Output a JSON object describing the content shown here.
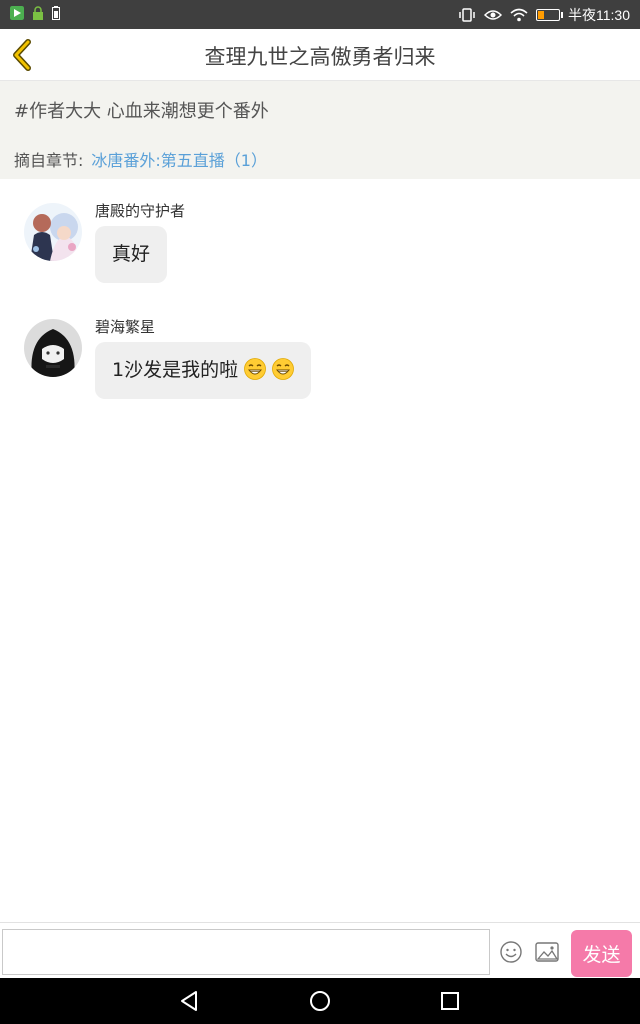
{
  "status_bar": {
    "time_text": "半夜11:30",
    "battery_level": 0.3,
    "icons": [
      "app-icon",
      "lock-icon",
      "battery-small-icon",
      "vibrate-icon",
      "eye-icon",
      "wifi-icon",
      "battery-icon"
    ]
  },
  "header": {
    "title": "查理九世之高傲勇者归来",
    "back_icon": "chevron-left-icon"
  },
  "quote": {
    "text": "#作者大大 心血来潮想更个番外",
    "source_label": "摘自章节:",
    "source_link": "冰唐番外:第五直播（1）"
  },
  "comments": [
    {
      "username": "唐殿的守护者",
      "message": "真好",
      "emojis": 0
    },
    {
      "username": "碧海繁星",
      "message": "1沙发是我的啦",
      "emojis": 2
    }
  ],
  "input_bar": {
    "placeholder": "",
    "send_label": "发送",
    "emoji_icon": "smiley-icon",
    "image_icon": "image-icon"
  },
  "navigation": {
    "icons": [
      "back-triangle-icon",
      "home-circle-icon",
      "recents-square-icon"
    ]
  },
  "colors": {
    "accent_pink": "#f57aa9",
    "link_blue": "#5aa0d8",
    "back_arrow_yellow": "#f2c200"
  }
}
